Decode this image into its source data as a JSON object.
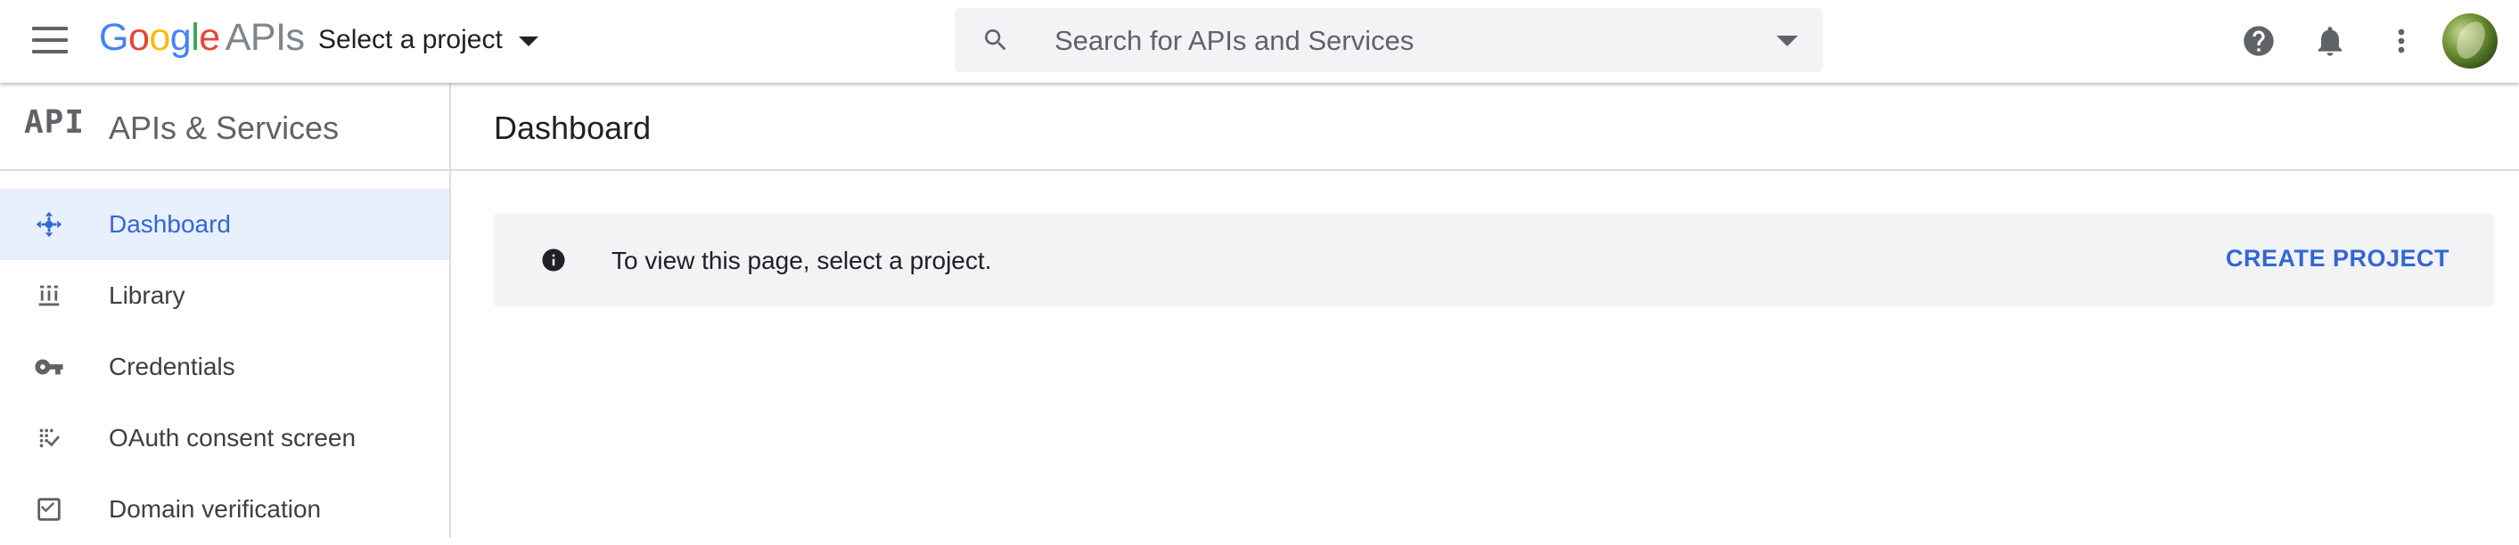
{
  "topbar": {
    "menu_icon": "hamburger-menu-icon",
    "logo": {
      "letters": [
        "G",
        "o",
        "o",
        "g",
        "l",
        "e"
      ],
      "suffix": "APIs"
    },
    "project_selector_label": "Select a project",
    "search": {
      "placeholder": "Search for APIs and Services",
      "value": ""
    },
    "icons": [
      "help-icon",
      "notifications-bell-icon",
      "more-vert-icon",
      "avatar"
    ]
  },
  "sidebar": {
    "logo_text": "API",
    "title": "APIs & Services",
    "items": [
      {
        "label": "Dashboard",
        "icon": "dashboard-icon",
        "active": true
      },
      {
        "label": "Library",
        "icon": "library-icon",
        "active": false
      },
      {
        "label": "Credentials",
        "icon": "key-icon",
        "active": false
      },
      {
        "label": "OAuth consent screen",
        "icon": "oauth-consent-icon",
        "active": false
      },
      {
        "label": "Domain verification",
        "icon": "checkbox-icon",
        "active": false
      }
    ]
  },
  "main": {
    "title": "Dashboard",
    "banner": {
      "message": "To view this page, select a project.",
      "action_label": "CREATE PROJECT"
    }
  },
  "colors": {
    "accent": "#3367d6",
    "active_bg": "#e8f0fe",
    "banner_bg": "#f1f3f4",
    "icon_gray": "#5f6368"
  }
}
